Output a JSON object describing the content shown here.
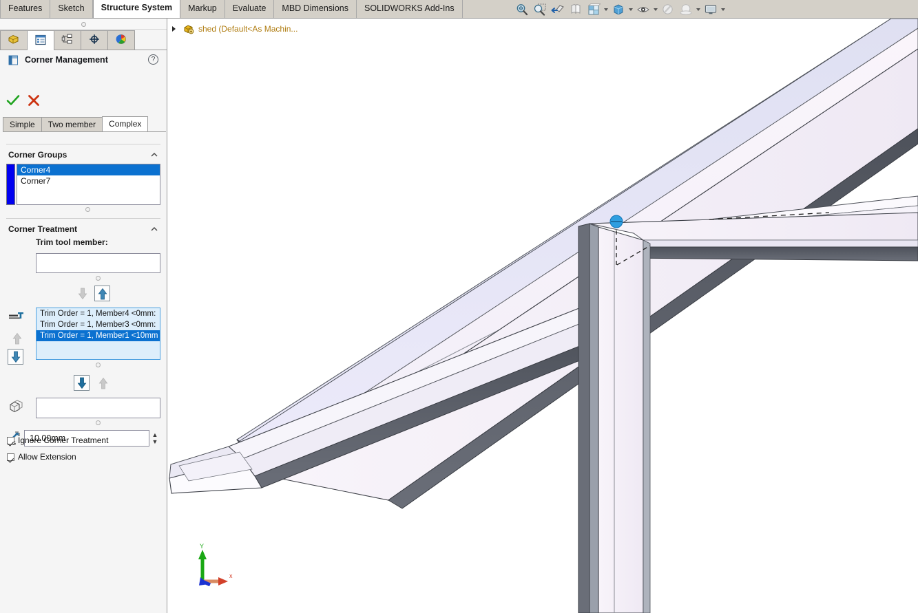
{
  "ribbon": {
    "tabs": [
      {
        "label": "Features",
        "active": false
      },
      {
        "label": "Sketch",
        "active": false
      },
      {
        "label": "Structure System",
        "active": true
      },
      {
        "label": "Markup",
        "active": false
      },
      {
        "label": "Evaluate",
        "active": false
      },
      {
        "label": "MBD Dimensions",
        "active": false
      },
      {
        "label": "SOLIDWORKS Add-Ins",
        "active": false
      }
    ]
  },
  "view_toolbar": {
    "items": [
      {
        "name": "zoom-to-fit-icon",
        "caret": false
      },
      {
        "name": "zoom-to-area-icon",
        "caret": false
      },
      {
        "name": "previous-view-icon",
        "caret": false
      },
      {
        "name": "section-view-icon",
        "caret": false
      },
      {
        "name": "view-orientation-icon",
        "caret": true
      },
      {
        "name": "display-style-icon",
        "caret": true
      },
      {
        "name": "hide-show-items-icon",
        "caret": true
      },
      {
        "name": "edit-appearance-icon",
        "caret": false
      },
      {
        "name": "apply-scene-icon",
        "caret": true
      },
      {
        "name": "view-settings-icon",
        "caret": true
      }
    ]
  },
  "manager_tabs": [
    {
      "name": "feature-manager-tab",
      "icon": "feature-tree-icon",
      "active": false
    },
    {
      "name": "property-manager-tab",
      "icon": "property-list-icon",
      "active": true
    },
    {
      "name": "configuration-manager-tab",
      "icon": "configuration-icon",
      "active": false
    },
    {
      "name": "dimxpert-manager-tab",
      "icon": "dimxpert-target-icon",
      "active": false
    },
    {
      "name": "display-manager-tab",
      "icon": "display-sphere-icon",
      "active": false
    }
  ],
  "property_manager": {
    "title": "Corner Management",
    "title_icon": "corner-management-icon",
    "help_glyph": "?",
    "ok_label": "OK",
    "cancel_label": "Cancel",
    "mode_tabs": [
      {
        "label": "Simple",
        "active": false
      },
      {
        "label": "Two member",
        "active": false
      },
      {
        "label": "Complex",
        "active": true
      }
    ],
    "corner_groups": {
      "header": "Corner Groups",
      "color_swatch": "#0000f0",
      "items": [
        {
          "label": "Corner4",
          "selected": true
        },
        {
          "label": "Corner7",
          "selected": false
        }
      ]
    },
    "corner_treatment": {
      "header": "Corner Treatment",
      "trim_tool_label": "Trim tool member:",
      "trim_tool_value": "",
      "trim_tool_placeholder": "",
      "move_up_button": "move-up",
      "move_down_button": "move-down",
      "trim_order_items": [
        {
          "label": "Trim Order = 1, Member4   <0mm:",
          "selected": false
        },
        {
          "label": "Trim Order = 1, Member3   <0mm:",
          "selected": false
        },
        {
          "label": "Trim Order = 1, Member1   <10mm",
          "selected": true
        }
      ],
      "secondary_selection_value": "",
      "gap_value": "10.00mm",
      "checkboxes": [
        {
          "label": "Ignore Corner Treatment",
          "checked": true
        },
        {
          "label": "Allow Extension",
          "checked": true
        }
      ]
    }
  },
  "feature_tree": {
    "root_label": "shed  (Default<As Machin...",
    "root_icon": "part-document-icon",
    "expand_icon": "chevron-right-icon"
  },
  "viewport": {
    "axis_triad": {
      "x_label": "x",
      "y_label": "Y",
      "z_label": "",
      "x_color": "#d2402a",
      "y_color": "#1aa814",
      "z_color": "#1a32d2"
    },
    "selection_marker_color": "#2e9ee0",
    "background": "#ffffff"
  },
  "colors": {
    "tab_bar": "#d4d0c8",
    "panel_bg": "#f5f5f5",
    "selection_blue": "#0b71d0",
    "list_highlight_bg": "#ddeefb",
    "metal_light": "#f6f3fa",
    "metal_shadow": "#565a63"
  }
}
